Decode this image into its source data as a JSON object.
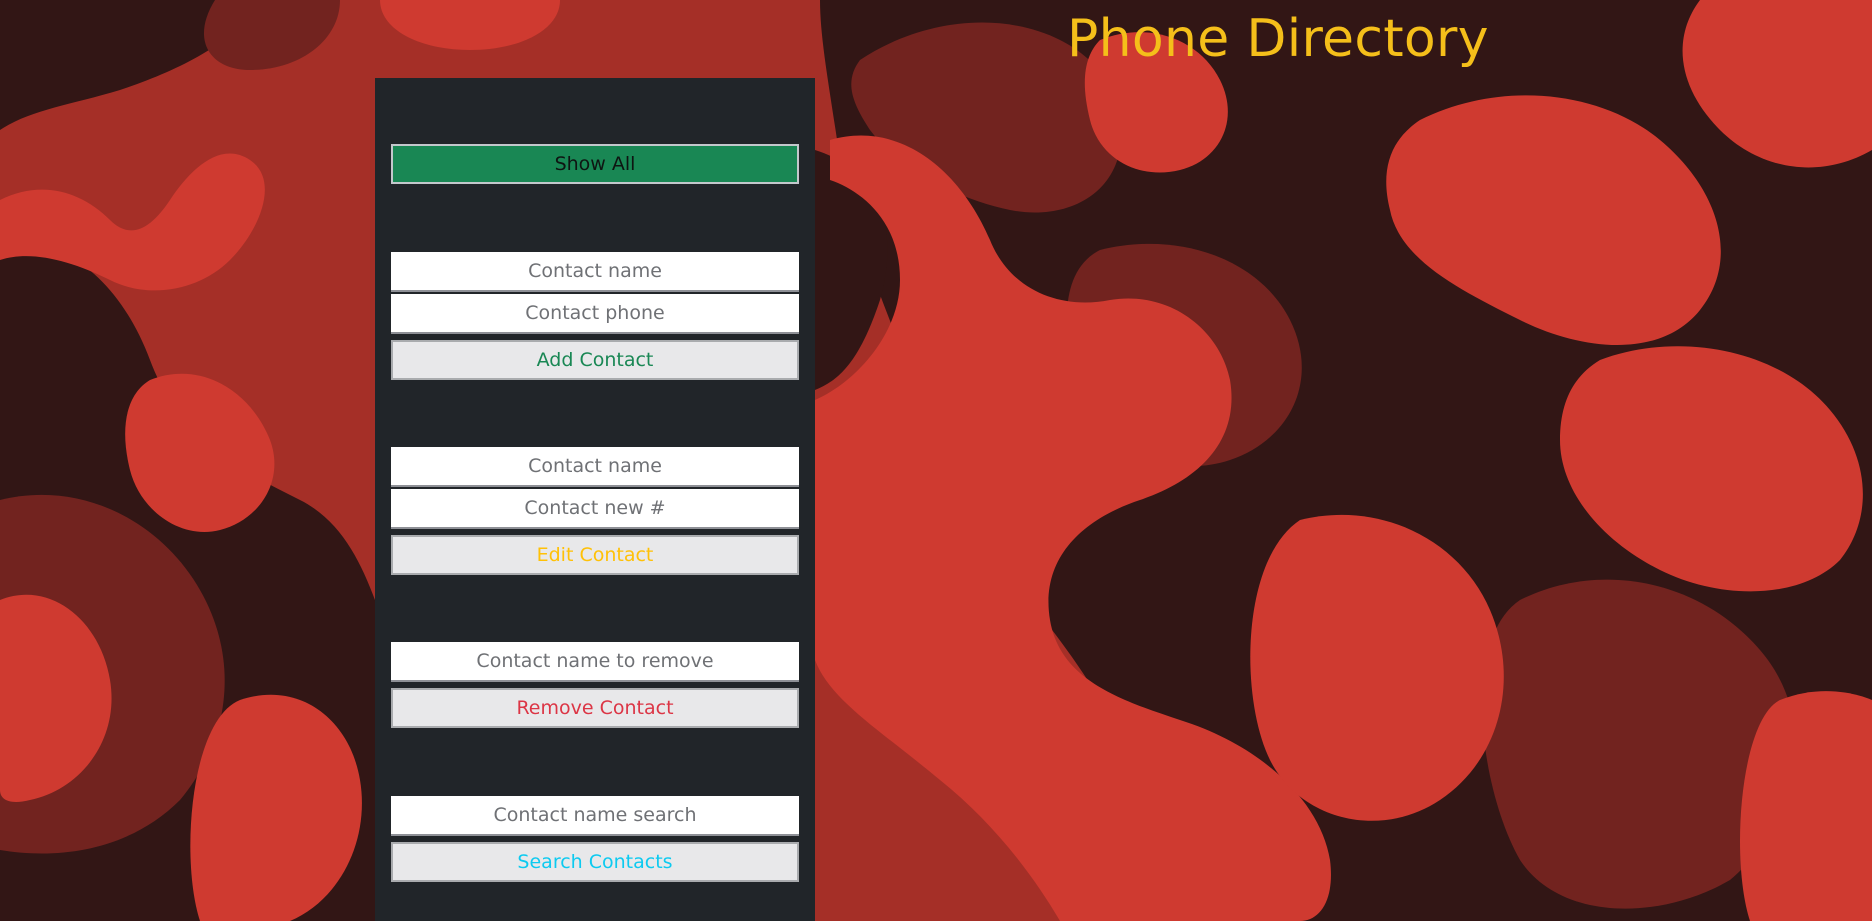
{
  "page": {
    "title": "Phone Directory"
  },
  "colors": {
    "background_red": "#a52f27",
    "camo_bright": "#cf3a30",
    "camo_dark": "#321615",
    "camo_mid": "#72231f",
    "panel": "#212529",
    "title": "#f5bf1a",
    "success": "#198754",
    "warning": "#ffc107",
    "danger": "#dc3545",
    "info": "#0dcaf0"
  },
  "panel": {
    "show_all_label": "Show All",
    "add": {
      "name_placeholder": "Contact name",
      "phone_placeholder": "Contact phone",
      "button_label": "Add Contact"
    },
    "edit": {
      "name_placeholder": "Contact name",
      "new_number_placeholder": "Contact new #",
      "button_label": "Edit Contact"
    },
    "remove": {
      "name_placeholder": "Contact name to remove",
      "button_label": "Remove Contact"
    },
    "search": {
      "name_placeholder": "Contact name search",
      "button_label": "Search Contacts"
    }
  }
}
